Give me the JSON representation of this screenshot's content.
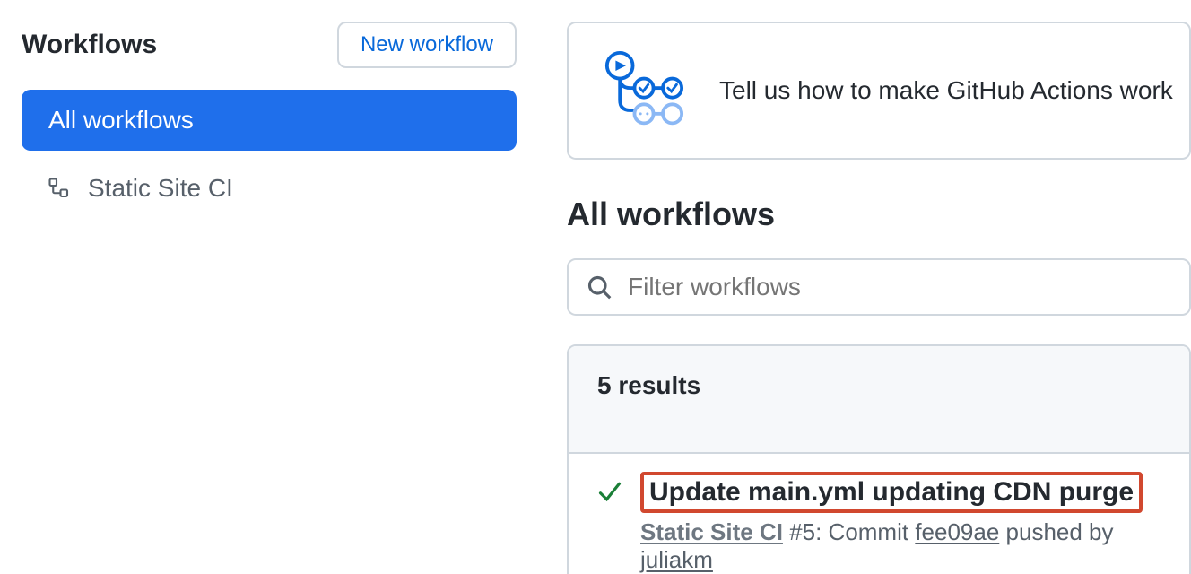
{
  "sidebar": {
    "title": "Workflows",
    "new_button": "New workflow",
    "items": [
      {
        "label": "All workflows",
        "active": true
      },
      {
        "label": "Static Site CI",
        "active": false
      }
    ]
  },
  "banner": {
    "text": "Tell us how to make GitHub Actions work"
  },
  "main": {
    "title": "All workflows",
    "filter_placeholder": "Filter workflows",
    "results_label": "5 results",
    "run": {
      "title": "Update main.yml updating CDN purge",
      "workflow_name": "Static Site CI",
      "run_number_prefix": " #5",
      "meta_middle": ": Commit ",
      "commit_sha": "fee09ae",
      "pushed_by_text": " pushed by ",
      "pusher": "juliakm"
    }
  }
}
